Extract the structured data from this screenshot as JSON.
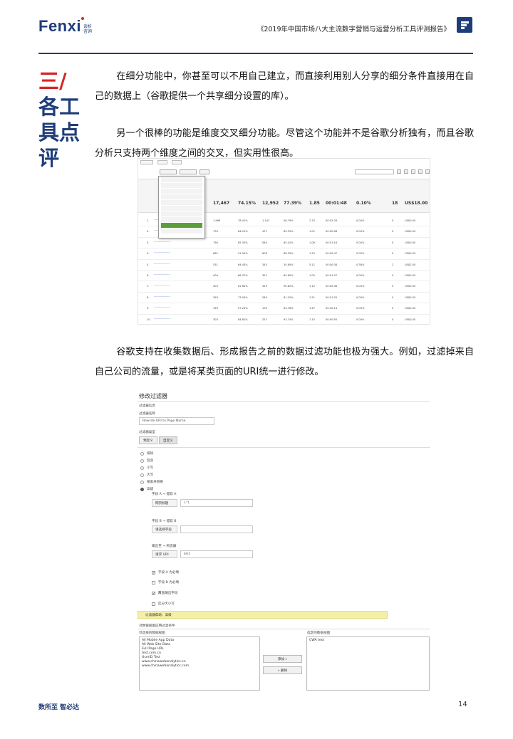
{
  "header": {
    "logo_text": "Fenxi",
    "logo_sub": "谈析咨询",
    "report_title": "《2019年中国市场八大主流数字营销与运营分析工具评测报告》"
  },
  "section": {
    "number": "三/",
    "title_lines": [
      "各工",
      "具点",
      "评"
    ]
  },
  "paragraphs": [
    "在细分功能中，你甚至可以不用自己建立，而直接利用别人分享的细分条件直接用在自己的数据上（谷歌提供一个共享细分设置的库）。",
    "另一个很棒的功能是维度交叉细分功能。尽管这个功能并不是谷歌分析独有，而且谷歌分析只支持两个维度之间的交叉，但实用性很高。",
    "谷歌支持在收集数据后、形成报告之前的数据过滤功能也极为强大。例如，过滤掉来自自己公司的流量，或是将某类页面的URI统一进行修改。"
  ],
  "screenshot1": {
    "summary": [
      "17,467",
      "74.15%",
      "12,952",
      "77.39%",
      "1.85",
      "00:01:48",
      "0.10%",
      "18",
      "US$18.00"
    ],
    "rows": [
      {
        "n": "1.",
        "v": [
          "1,969",
          "78.41%",
          "1,142",
          "56.79%",
          "2.75",
          "00:02:33",
          "0.00%",
          "0",
          "US$0.00"
        ]
      },
      {
        "n": "2.",
        "v": [
          "790",
          "84.10%",
          "471",
          "89.55%",
          "1.01",
          "00:00:08",
          "0.00%",
          "0",
          "US$0.00"
        ]
      },
      {
        "n": "3.",
        "v": [
          "736",
          "85.33%",
          "584",
          "85.42%",
          "1.06",
          "00:01:16",
          "0.00%",
          "0",
          "US$0.00"
        ]
      },
      {
        "n": "4.",
        "v": [
          "662",
          "91.54%",
          "606",
          "86.35%",
          "1.25",
          "00:00:47",
          "0.00%",
          "0",
          "US$0.00"
        ]
      },
      {
        "n": "5.",
        "v": [
          "531",
          "64.43%",
          "343",
          "34.84%",
          "5.11",
          "00:00:34",
          "0.38%",
          "2",
          "US$2.00"
        ]
      },
      {
        "n": "6.",
        "v": [
          "404",
          "86.37%",
          "357",
          "84.65%",
          "1.05",
          "00:01:27",
          "0.00%",
          "0",
          "US$0.00"
        ]
      },
      {
        "n": "7.",
        "v": [
          "403",
          "81.64%",
          "329",
          "90.82%",
          "1.12",
          "00:00:36",
          "0.00%",
          "0",
          "US$0.00"
        ]
      },
      {
        "n": "8.",
        "v": [
          "393",
          "73.54%",
          "289",
          "81.42%",
          "1.51",
          "00:01:25",
          "0.00%",
          "0",
          "US$0.00"
        ]
      },
      {
        "n": "9.",
        "v": [
          "339",
          "57.23%",
          "194",
          "83.78%",
          "1.47",
          "00:00:14",
          "0.00%",
          "0",
          "US$0.00"
        ]
      },
      {
        "n": "10.",
        "v": [
          "303",
          "84.82%",
          "257",
          "92.74%",
          "1.15",
          "00:00:50",
          "0.00%",
          "0",
          "US$0.00"
        ]
      }
    ]
  },
  "screenshot2": {
    "title": "修改过滤器",
    "info": "过滤器信息",
    "name_label": "过滤器名称",
    "name_value": "Rewrite URI to Page Name",
    "type_label": "过滤器类型",
    "btn_predefined": "预定义",
    "btn_custom": "自定义",
    "options": [
      "排除",
      "包含",
      "小写",
      "大写",
      "搜索并替换",
      "高级"
    ],
    "field_a": "字段 A → 提取 A",
    "field_a_select": "网页标题",
    "field_a_value": "(.*)",
    "field_b": "字段 B → 提取 B",
    "field_b_select": "请选择字段",
    "output": "输出至 → 构造器",
    "output_select": "请求 URI",
    "output_value": "$A1",
    "checks": [
      "字段 A 为必填",
      "字段 B 为必填",
      "覆盖输出字段",
      "区分大小写"
    ],
    "help": "过滤器帮助：高级",
    "apply_label": "对数据视图应用过滤条件",
    "available_label": "可选择的数据视图",
    "selected_label": "选定的数据视图",
    "available": [
      "All Mobile App Data",
      "All Web Site Data",
      "Full Page URL",
      "test.com.cn",
      "UserID Test",
      "www.chinawebanalytics.cn",
      "www.chinawebanalytics.com"
    ],
    "selected": [
      "CWA test"
    ],
    "add_btn": "添加 »",
    "remove_btn": "« 删除"
  },
  "footer": {
    "slogan": "数所至  智必达",
    "page": "14"
  },
  "colors": {
    "brand_blue": "#1f3d7a",
    "accent_red": "#d62828"
  }
}
